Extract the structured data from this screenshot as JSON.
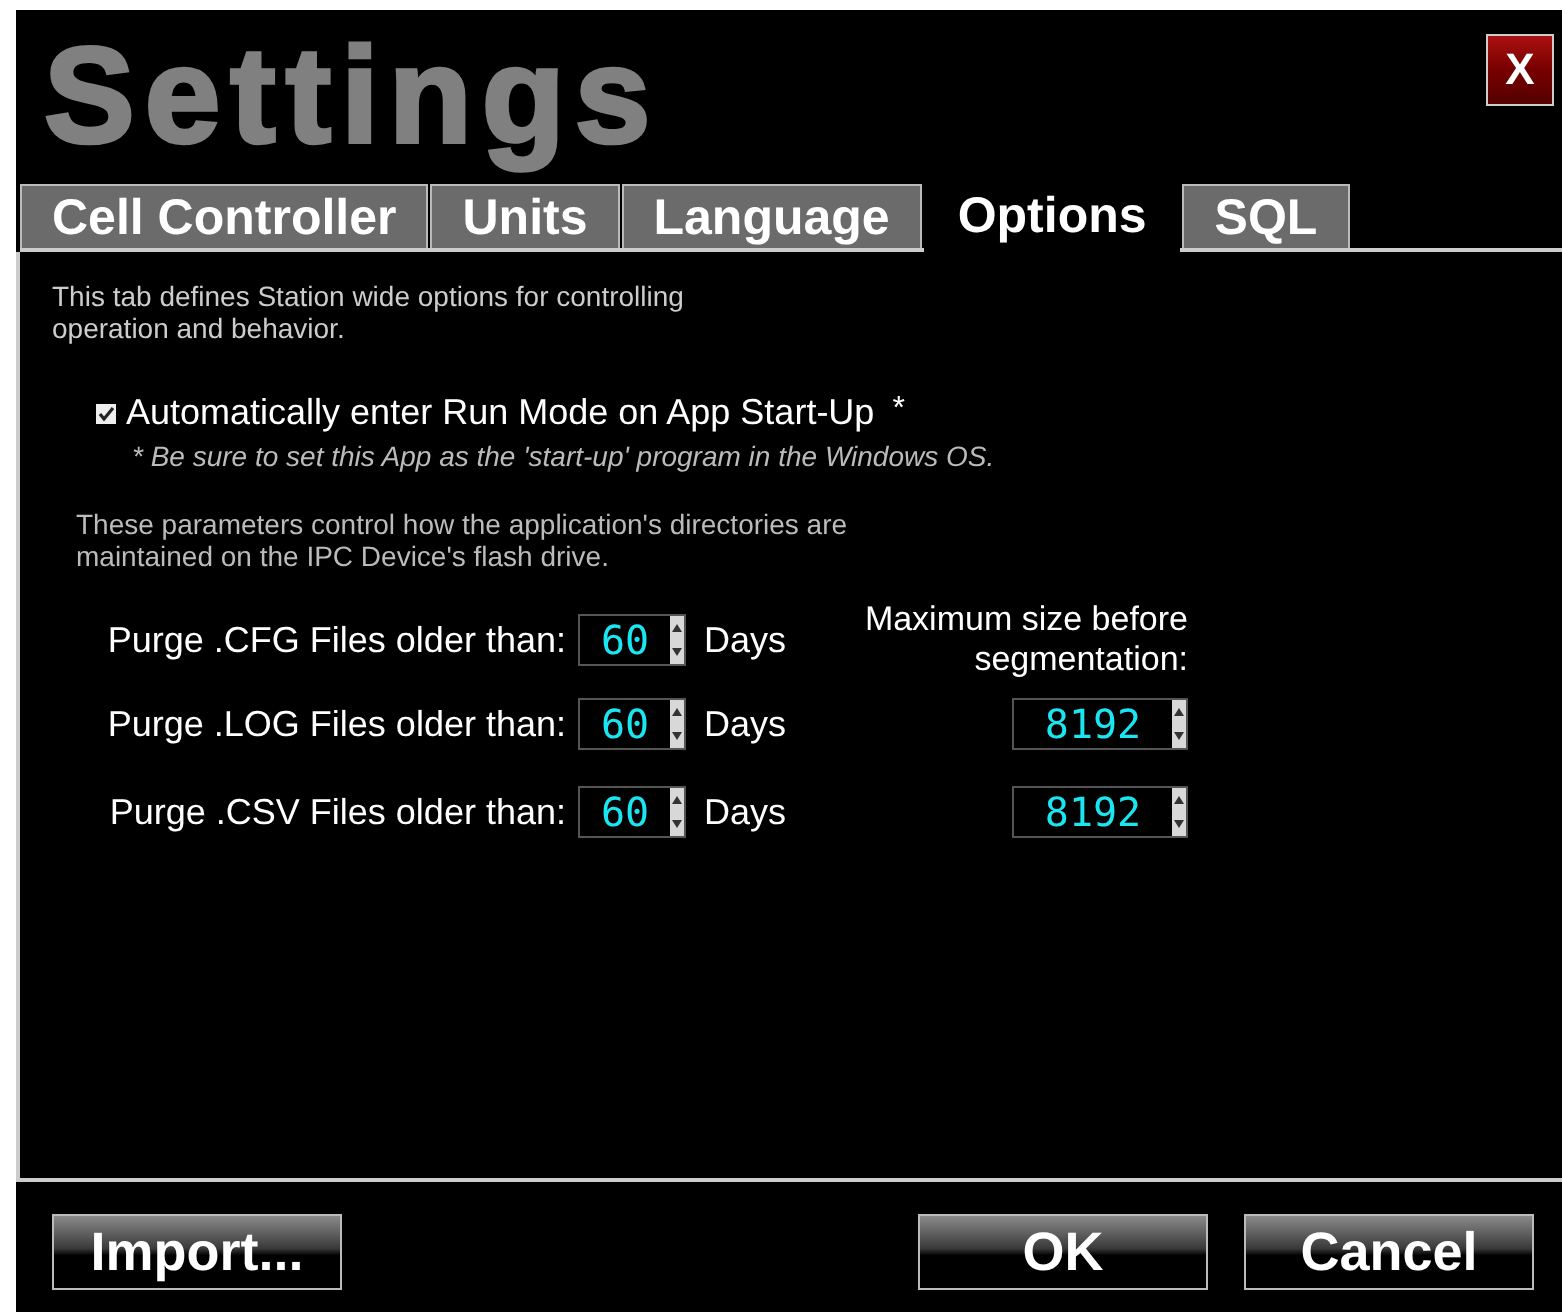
{
  "window": {
    "title": "Settings",
    "close_label": "X"
  },
  "tabs": [
    {
      "label": "Cell Controller",
      "selected": false
    },
    {
      "label": "Units",
      "selected": false
    },
    {
      "label": "Language",
      "selected": false
    },
    {
      "label": "Options",
      "selected": true
    },
    {
      "label": "SQL",
      "selected": false
    }
  ],
  "options": {
    "description": "This tab defines Station wide options for controlling operation and behavior.",
    "auto_run": {
      "label": "Automatically enter Run Mode on App Start-Up",
      "asterisk": "*",
      "checked": true
    },
    "note": "* Be sure to set this App as the 'start-up' program in the Windows OS.",
    "directories_note": "These parameters control how the application's directories are maintained on the IPC Device's flash drive.",
    "max_size_heading": "Maximum size before segmentation:",
    "purge_rows": [
      {
        "label": "Purge .CFG Files older than:",
        "days": "60",
        "unit": "Days"
      },
      {
        "label": "Purge .LOG Files older than:",
        "days": "60",
        "unit": "Days",
        "max_size": "8192"
      },
      {
        "label": "Purge .CSV Files older than:",
        "days": "60",
        "unit": "Days",
        "max_size": "8192"
      }
    ]
  },
  "buttons_left": [
    "Import..."
  ],
  "buttons_right": [
    "OK",
    "Cancel"
  ]
}
